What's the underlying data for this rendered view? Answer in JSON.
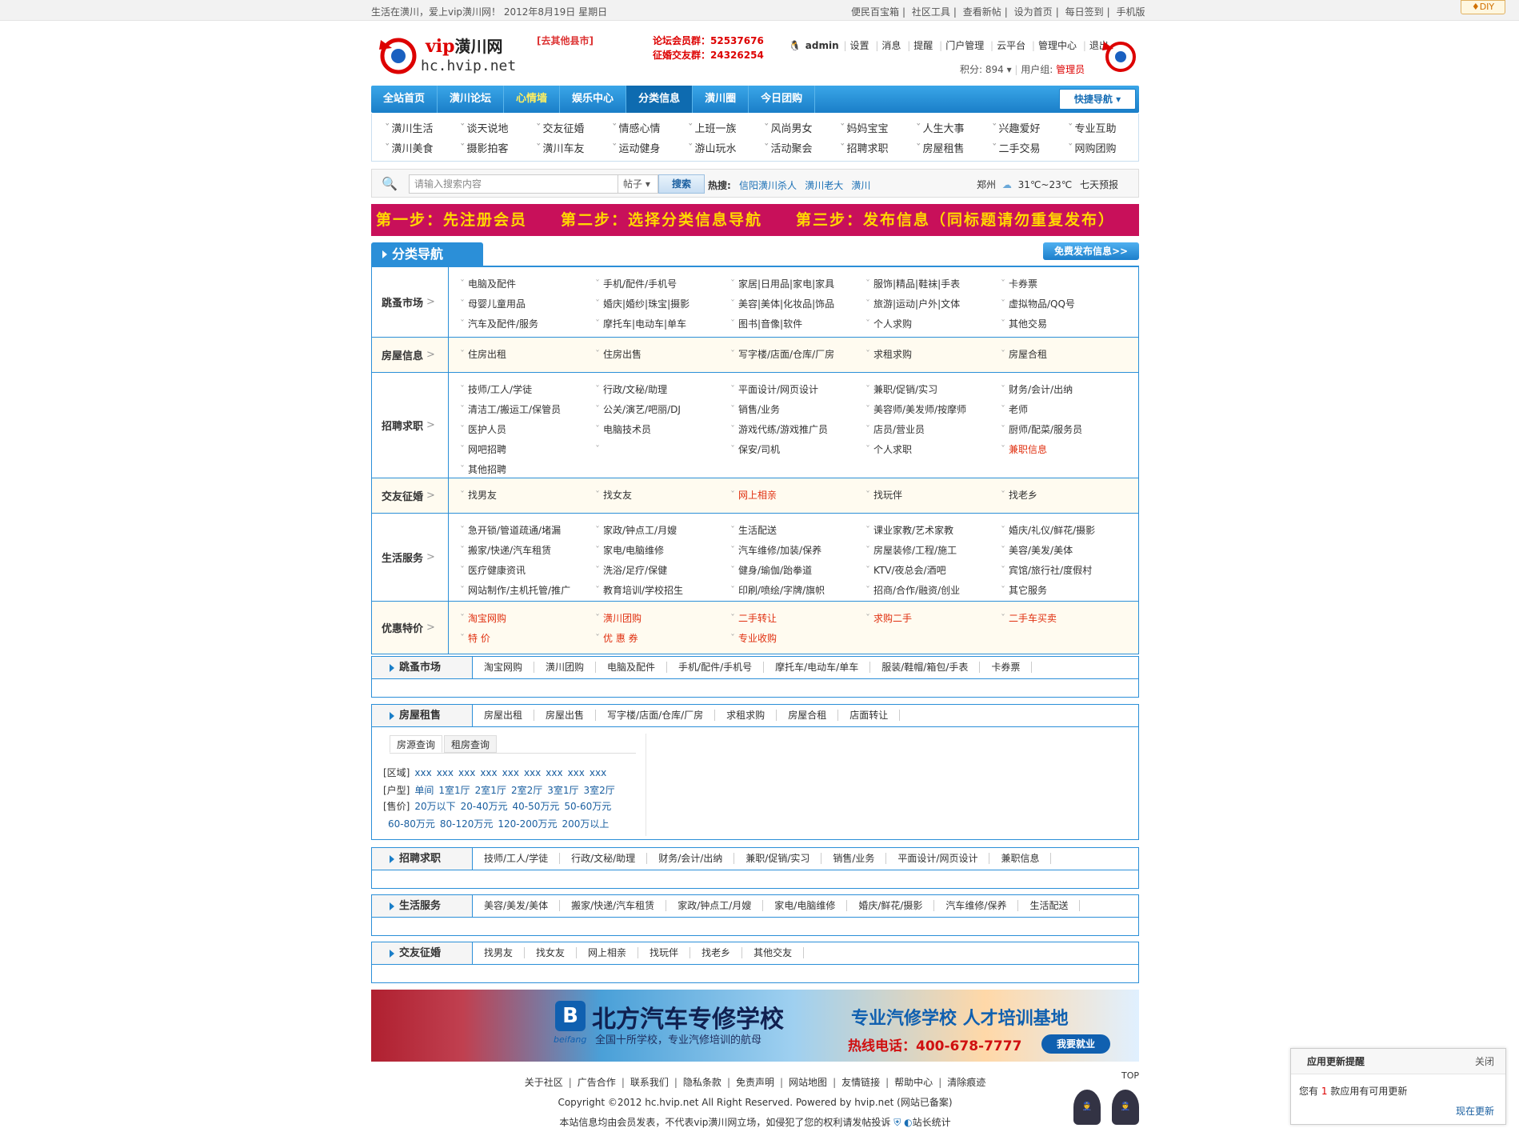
{
  "topbar": {
    "left": "生活在潢川，爱上vip潢川网！ 2012年8月19日 星期日",
    "links": [
      "便民百宝箱",
      "社区工具",
      "查看新帖",
      "设为首页",
      "每日签到",
      "手机版"
    ],
    "diy": "♦DIY"
  },
  "header": {
    "logo_vip": "vip",
    "logo_cn": "潢川网",
    "logo_url": "hc.hvip.net",
    "go_county": "[去其他县市]",
    "qq1": "论坛会员群：52537676",
    "qq2": "征婚交友群：24326254",
    "username": "admin",
    "user_links": [
      "设置",
      "消息",
      "提醒",
      "门户管理",
      "云平台",
      "管理中心",
      "退出"
    ],
    "points": "积分: 894",
    "usergroup_label": "用户组:",
    "usergroup": "管理员"
  },
  "nav": {
    "items": [
      "全站首页",
      "潢川论坛",
      "心情墙",
      "娱乐中心",
      "分类信息",
      "潢川圈",
      "今日团购"
    ],
    "quick": "快捷导航"
  },
  "subnav": {
    "row1": [
      "潢川生活",
      "谈天说地",
      "交友征婚",
      "情感心情",
      "上班一族",
      "风尚男女",
      "妈妈宝宝",
      "人生大事",
      "兴趣爱好",
      "专业互助"
    ],
    "row2": [
      "潢川美食",
      "摄影拍客",
      "潢川车友",
      "运动健身",
      "游山玩水",
      "活动聚会",
      "招聘求职",
      "房屋租售",
      "二手交易",
      "网购团购"
    ]
  },
  "search": {
    "placeholder": "请输入搜索内容",
    "type": "帖子",
    "button": "搜索",
    "hot_label": "热搜:",
    "hot": [
      "信阳潢川杀人",
      "潢川老大",
      "潢川"
    ],
    "city": "郑州",
    "temp": "31℃~23℃",
    "forecast": "七天预报"
  },
  "banner": "第一步：先注册会员　　第二步：选择分类信息导航　　第三步：发布信息（同标题请勿重复发布）",
  "catnav": {
    "title": "分类导航",
    "free": "免费发布信息>>",
    "rows": [
      {
        "label": "跳蚤市场",
        "items": [
          "电脑及配件",
          "手机/配件/手机号",
          "家居|日用品|家电|家具",
          "服饰|精品|鞋袜|手表",
          "卡券票",
          "母婴儿童用品",
          "婚庆|婚纱|珠宝|摄影",
          "美容|美体|化妆品|饰品",
          "旅游|运动|户外|文体",
          "虚拟物品/QQ号",
          "汽车及配件/服务",
          "摩托车|电动车|单车",
          "图书|音像|软件",
          "个人求购",
          "其他交易"
        ]
      },
      {
        "label": "房屋信息",
        "items": [
          "住房出租",
          "住房出售",
          "写字楼/店面/仓库/厂房",
          "求租求购",
          "房屋合租"
        ]
      },
      {
        "label": "招聘求职",
        "items": [
          "技师/工人/学徒",
          "行政/文秘/助理",
          "平面设计/网页设计",
          "兼职/促销/实习",
          "财务/会计/出纳",
          "清洁工/搬运工/保管员",
          "公关/演艺/吧丽/DJ",
          "销售/业务",
          "美容师/美发师/按摩师",
          "老师",
          "医护人员",
          "电脑技术员",
          "游戏代练/游戏推广员",
          "店员/营业员",
          "厨师/配菜/服务员",
          "网吧招聘",
          "",
          "保安/司机",
          "个人求职",
          "兼职信息",
          "其他招聘"
        ]
      },
      {
        "label": "交友征婚",
        "items": [
          "找男友",
          "找女友",
          "网上相亲",
          "找玩伴",
          "找老乡"
        ]
      },
      {
        "label": "生活服务",
        "items": [
          "急开锁/管道疏通/堵漏",
          "家政/钟点工/月嫂",
          "生活配送",
          "课业家教/艺术家教",
          "婚庆/礼仪/鲜花/摄影",
          "搬家/快递/汽车租赁",
          "家电/电脑维修",
          "汽车维修/加装/保养",
          "房屋装修/工程/施工",
          "美容/美发/美体",
          "医疗健康资讯",
          "洗浴/足疗/保健",
          "健身/瑜伽/跆拳道",
          "KTV/夜总会/酒吧",
          "宾馆/旅行社/度假村",
          "网站制作/主机托管/推广",
          "教育培训/学校招生",
          "印刷/喷绘/字牌/旗帜",
          "招商/合作/融资/创业",
          "其它服务"
        ]
      },
      {
        "label": "优惠特价",
        "items": [
          "淘宝网购",
          "潢川团购",
          "二手转让",
          "求购二手",
          "二手车买卖",
          "特 价",
          "优 惠 券",
          "专业收购"
        ]
      }
    ]
  },
  "sections": {
    "flea": {
      "title": "跳蚤市场",
      "links": [
        "淘宝网购",
        "潢川团购",
        "电脑及配件",
        "手机/配件/手机号",
        "摩托车/电动车/单车",
        "服装/鞋帽/箱包/手表",
        "卡券票"
      ]
    },
    "house": {
      "title": "房屋租售",
      "links": [
        "房屋出租",
        "房屋出售",
        "写字楼/店面/仓库/厂房",
        "求租求购",
        "房屋合租",
        "店面转让"
      ],
      "tabs": [
        "房源查询",
        "租房查询"
      ],
      "area_label": "[区域]",
      "area": [
        "xxx",
        "xxx",
        "xxx",
        "xxx",
        "xxx",
        "xxx",
        "xxx",
        "xxx",
        "xxx"
      ],
      "type_label": "[户型]",
      "type": [
        "单间",
        "1室1厅",
        "2室1厅",
        "2室2厅",
        "3室1厅",
        "3室2厅"
      ],
      "price_label": "[售价]",
      "price": [
        "20万以下",
        "20-40万元",
        "40-50万元",
        "50-60万元",
        "60-80万元",
        "80-120万元",
        "120-200万元",
        "200万以上"
      ]
    },
    "jobs": {
      "title": "招聘求职",
      "links": [
        "技师/工人/学徒",
        "行政/文秘/助理",
        "财务/会计/出纳",
        "兼职/促销/实习",
        "销售/业务",
        "平面设计/网页设计",
        "兼职信息"
      ]
    },
    "life": {
      "title": "生活服务",
      "links": [
        "美容/美发/美体",
        "搬家/快递/汽车租赁",
        "家政/钟点工/月嫂",
        "家电/电脑维修",
        "婚庆/鲜花/摄影",
        "汽车维修/保养",
        "生活配送"
      ]
    },
    "dating": {
      "title": "交友征婚",
      "links": [
        "找男友",
        "找女友",
        "网上相亲",
        "找玩伴",
        "找老乡",
        "其他交友"
      ]
    }
  },
  "ad": {
    "logo": "B",
    "brand": "beifang",
    "title": "北方汽车专修学校",
    "sub": "全国十所学校，专业汽修培训的航母",
    "right": "专业汽修学校 人才培训基地",
    "phone": "热线电话：400-678-7777",
    "btn": "我要就业"
  },
  "footer": {
    "links": [
      "关于社区",
      "广告合作",
      "联系我们",
      "隐私条款",
      "免责声明",
      "网站地图",
      "友情链接",
      "帮助中心",
      "清除痕迹"
    ],
    "copy": "Copyright ©2012 hc.hvip.net All Right Reserved.  Powered by hvip.net (网站已备案)",
    "note": "本站信息均由会员发表，不代表vip潢川网立场，如侵犯了您的权利请发帖投诉",
    "stat": "站长统计",
    "top": "TOP"
  },
  "popup": {
    "title": "应用更新提醒",
    "close": "关闭",
    "text_pre": "您有",
    "count": "1",
    "text_post": "款应用有可用更新",
    "update": "现在更新"
  }
}
